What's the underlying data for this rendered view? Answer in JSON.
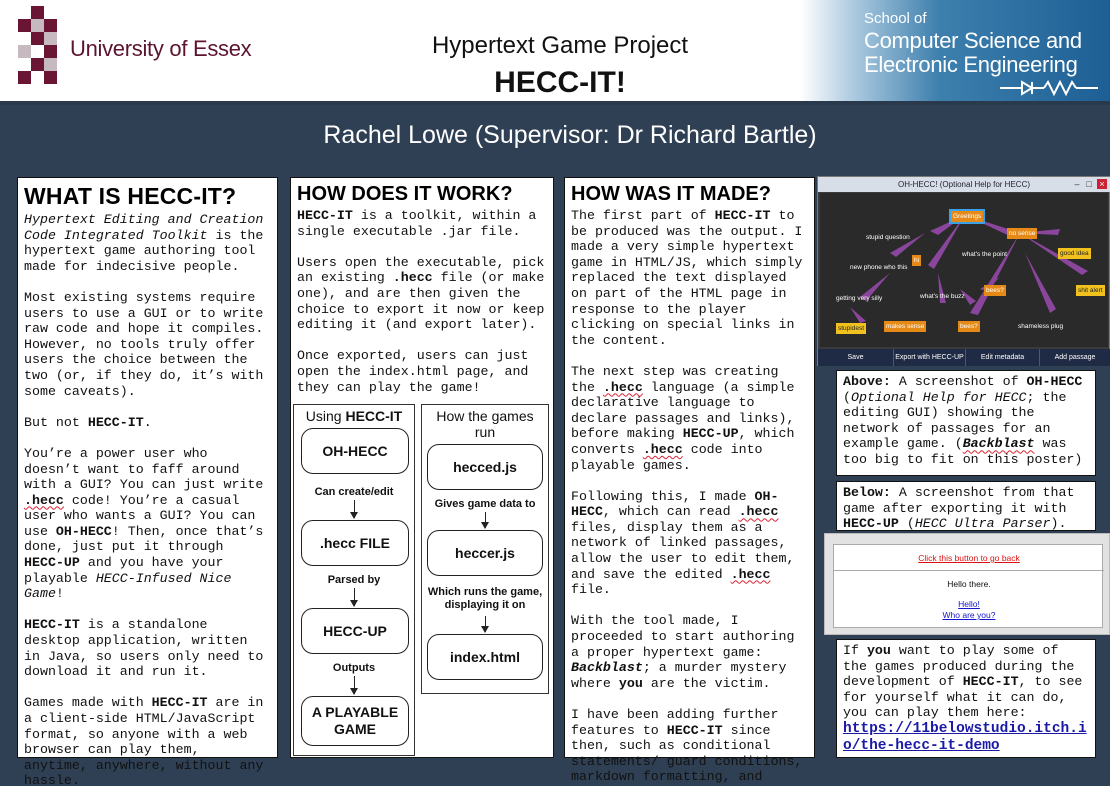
{
  "header": {
    "university": "University of Essex",
    "title_small": "Hypertext Game Project",
    "title_big": "HECC-IT!",
    "school_small": "School of",
    "school_line1": "Computer Science and",
    "school_line2": "Electronic Engineering"
  },
  "author": "Rachel Lowe (Supervisor: Dr Richard Bartle)",
  "col1": {
    "heading": "WHAT IS HECC-IT?",
    "p1_italic": "Hypertext Editing and Creation Code Integrated Toolkit",
    "p1_rest": " is the hypertext game authoring tool made for indecisive people.",
    "p2": "Most existing systems require users to use a GUI or to write raw code and hope it compiles. However, no tools truly offer users the choice between the two (or, if they do, it’s with some caveats).",
    "p3_a": "But not ",
    "p3_b": "HECC-IT",
    "p3_c": ".",
    "p4_a": "You’re a power user who doesn’t want to faff around with a GUI? You can just write ",
    "p4_b": ".hecc",
    "p4_c": " code! You’re a casual user who wants a GUI? You can use ",
    "p4_d": "OH-HECC",
    "p4_e": "! Then, once that’s done, just put it through ",
    "p4_f": "HECC-UP",
    "p4_g": " and you have your playable ",
    "p4_h": "HECC-Infused Nice Game",
    "p4_i": "!",
    "p5_a": "HECC-IT",
    "p5_b": " is a standalone desktop application, written in Java, so users only need to download it and run it.",
    "p6_a": "Games made with ",
    "p6_b": "HECC-IT",
    "p6_c": " are in a client-side HTML/JavaScript format, so anyone with a web browser can play them, anytime, anywhere, without any hassle."
  },
  "col2": {
    "heading": "HOW DOES IT WORK?",
    "p1_a": "HECC-IT",
    "p1_b": " is a toolkit, within a single executable .jar file.",
    "p2_a": "Users open the executable, pick an existing ",
    "p2_b": ".hecc",
    "p2_c": " file (or make one), and are then given the choice to export it now or keep editing it (and export later).",
    "p3": "Once exported, users can just open the index.html page, and they can play the game!",
    "diagram": {
      "left_title_a": "Using ",
      "left_title_b": "HECC-IT",
      "right_title": "How the games run",
      "n_ohhecc": "OH-HECC",
      "e_create": "Can create/edit",
      "n_heccfile": ".hecc FILE",
      "e_parsed": "Parsed by",
      "n_heccup": "HECC-UP",
      "e_outputs": "Outputs",
      "n_game": "A PLAYABLE GAME",
      "n_hecced": "hecced.js",
      "e_gives": "Gives game data to",
      "n_heccer": "heccer.js",
      "e_runs": "Which runs the game, displaying it on",
      "n_index": "index.html"
    }
  },
  "col3": {
    "heading": "HOW WAS IT MADE?",
    "p1_a": "The first part of ",
    "p1_b": "HECC-IT",
    "p1_c": " to be produced was the output. I made a very simple hypertext game in HTML/JS, which simply replaced the text displayed on part of the HTML page in response to the player clicking on special links in the content.",
    "p2_a": "The next step was creating the ",
    "p2_b": ".hecc",
    "p2_c": " language (a simple declarative language to declare passages and links), before making ",
    "p2_d": "HECC-UP",
    "p2_e": ", which converts ",
    "p2_f": ".hecc",
    "p2_g": " code into playable games.",
    "p3_a": "Following this, I made ",
    "p3_b": "OH-HECC",
    "p3_c": ", which can read ",
    "p3_d": ".hecc",
    "p3_e": " files, display them as a network of linked passages, allow the user to edit them, and save the edited ",
    "p3_f": ".hecc",
    "p3_g": " file.",
    "p4_a": "With the tool made, I proceeded to start authoring a proper hypertext game: ",
    "p4_b": "Backblast",
    "p4_c": "; a murder mystery where ",
    "p4_d": "you",
    "p4_e": " are the victim.",
    "p5_a": "I have been adding further features to ",
    "p5_b": "HECC-IT",
    "p5_c": " since then, such as conditional statements/ guard conditions, markdown formatting, and extra usability features for authors."
  },
  "screenshot_ohhecc": {
    "window_title": "OH-HECC! (Optional Help for HECC)",
    "nodes": [
      "Greetings",
      "stupid question",
      "no sense",
      "good idea",
      "new phone who this",
      "hi",
      "what's the point",
      "getting very silly",
      "what's the buzz",
      "bees?",
      "shit alert",
      "stupidest",
      "makes sense",
      "bees?",
      "shameless plug"
    ],
    "buttons": [
      "Save",
      "Export with HECC-UP",
      "Edit metadata",
      "Add passage"
    ]
  },
  "caption_above": {
    "a": "Above:",
    "b": " A screenshot of ",
    "c": "OH-HECC",
    "d": " (",
    "e": "Optional Help for HECC",
    "f": "; the editing GUI) showing the network of passages for an example game. (",
    "g": "Backblast",
    "h": " was too big to fit on this poster)"
  },
  "caption_below": {
    "a": "Below:",
    "b": " A screenshot from that game after exporting it with ",
    "c": "HECC-UP",
    "d": " (",
    "e": "HECC Ultra Parser",
    "f": ")."
  },
  "screenshot_game": {
    "back_link": "Click this button to go back",
    "hello": "Hello there.",
    "link1": "Hello!",
    "link2": "Who are you?"
  },
  "caption_play": {
    "a": "If ",
    "b": "you",
    "c": " want to play some of the games produced during the development of ",
    "d": "HECC-IT",
    "e": ", to see for yourself what it can do, you can play them here:",
    "link": "https://11belowstudio.itch.io/the-hecc-it-demo"
  },
  "colors": {
    "background": "#2f4055",
    "essex_purple": "#5c1430",
    "node_orange": "#e58a16",
    "node_yellow": "#f1c21e",
    "link_blue": "#1a1aa6"
  }
}
